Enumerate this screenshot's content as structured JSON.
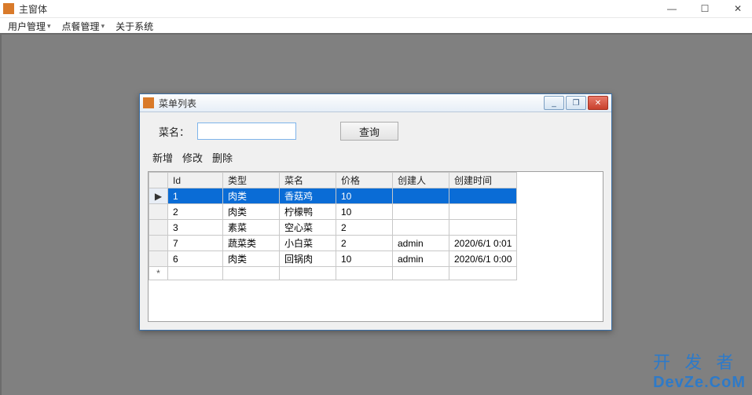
{
  "main_window": {
    "title": "主窗体",
    "controls": {
      "min": "—",
      "max": "☐",
      "close": "✕"
    }
  },
  "menubar": {
    "items": [
      {
        "label": "用户管理",
        "has_dropdown": true
      },
      {
        "label": "点餐管理",
        "has_dropdown": true
      },
      {
        "label": "关于系统",
        "has_dropdown": false
      }
    ]
  },
  "child_window": {
    "title": "菜单列表",
    "controls": {
      "min": "_",
      "max": "❐",
      "close": "✕"
    },
    "search": {
      "label": "菜名：",
      "value": "",
      "placeholder": "",
      "button": "查询"
    },
    "toolbar": {
      "add": "新增",
      "edit": "修改",
      "delete": "删除"
    },
    "grid": {
      "columns": [
        "Id",
        "类型",
        "菜名",
        "价格",
        "创建人",
        "创建时间"
      ],
      "rows": [
        {
          "id": "1",
          "type": "肉类",
          "name": "香菇鸡",
          "price": "10",
          "creator": "",
          "time": "",
          "selected": true
        },
        {
          "id": "2",
          "type": "肉类",
          "name": "柠檬鸭",
          "price": "10",
          "creator": "",
          "time": ""
        },
        {
          "id": "3",
          "type": "素菜",
          "name": "空心菜",
          "price": "2",
          "creator": "",
          "time": ""
        },
        {
          "id": "7",
          "type": "蔬菜类",
          "name": "小白菜",
          "price": "2",
          "creator": "admin",
          "time": "2020/6/1 0:01"
        },
        {
          "id": "6",
          "type": "肉类",
          "name": "回锅肉",
          "price": "10",
          "creator": "admin",
          "time": "2020/6/1 0:00"
        }
      ],
      "row_indicator_selected": "▶",
      "row_indicator_new": "*"
    }
  },
  "watermark": {
    "line1": "开 发 者",
    "line2": "DevZe.CoM"
  }
}
